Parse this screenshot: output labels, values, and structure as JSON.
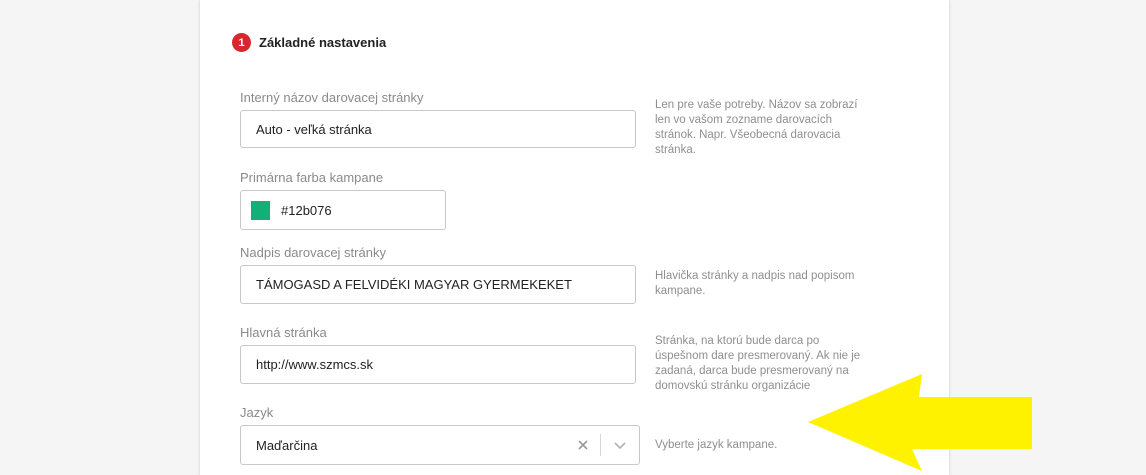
{
  "section": {
    "step_number": "1",
    "title": "Základné nastavenia"
  },
  "fields": {
    "internal_name": {
      "label": "Interný názov darovacej stránky",
      "value": "Auto - veľká stránka",
      "help": "Len pre vaše potreby. Názov sa zobrazí len vo vašom zozname darovacích stránok. Napr. Všeobecná darovacia stránka."
    },
    "primary_color": {
      "label": "Primárna farba kampane",
      "value": "#12b076",
      "swatch_color": "#12b076"
    },
    "page_heading": {
      "label": "Nadpis darovacej stránky",
      "value": "TÁMOGASD A FELVIDÉKI MAGYAR GYERMEKEKET",
      "help": "Hlavička stránky a nadpis nad popisom kampane."
    },
    "main_page": {
      "label": "Hlavná stránka",
      "value": "http://www.szmcs.sk",
      "help": "Stránka, na ktorú bude darca po úspešnom dare presmerovaný. Ak nie je zadaná, darca bude presmerovaný na domovskú stránku organizácie"
    },
    "language": {
      "label": "Jazyk",
      "value": "Maďarčina",
      "help": "Vyberte jazyk kampane."
    }
  },
  "colors": {
    "step_badge": "#d9262c",
    "annotation_arrow": "#fff200"
  },
  "icons": {
    "clear": "close-icon",
    "dropdown": "chevron-down-icon",
    "annotation": "arrow-left-icon"
  }
}
